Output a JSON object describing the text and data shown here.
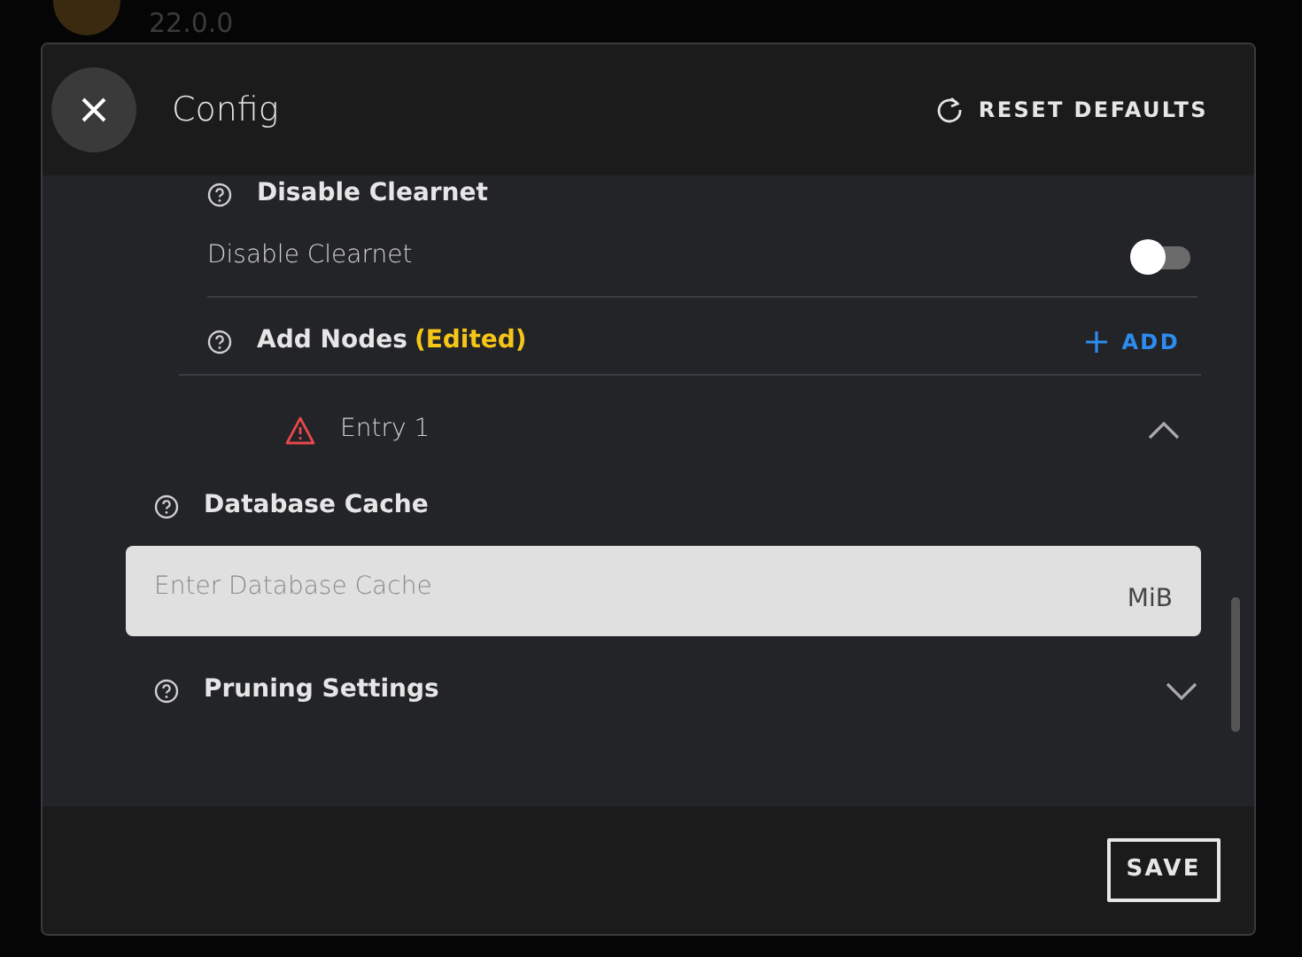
{
  "background": {
    "version": "22.0.0"
  },
  "header": {
    "title": "Config",
    "reset_label": "RESET DEFAULTS"
  },
  "fields": [
    {
      "kind": "toggle",
      "title": "Disable Clearnet",
      "label": "Disable Clearnet",
      "on": false
    },
    {
      "kind": "list",
      "title": "Add Nodes",
      "badge": "(Edited)",
      "add_label": "ADD",
      "entries": [
        {
          "label": "Entry 1",
          "invalid": true,
          "expanded": true
        }
      ]
    },
    {
      "kind": "number",
      "title": "Database Cache",
      "placeholder": "Enter Database Cache",
      "unit": "MiB"
    },
    {
      "kind": "object",
      "title": "Pruning Settings",
      "expanded": false
    }
  ],
  "footer": {
    "save_label": "SAVE"
  }
}
